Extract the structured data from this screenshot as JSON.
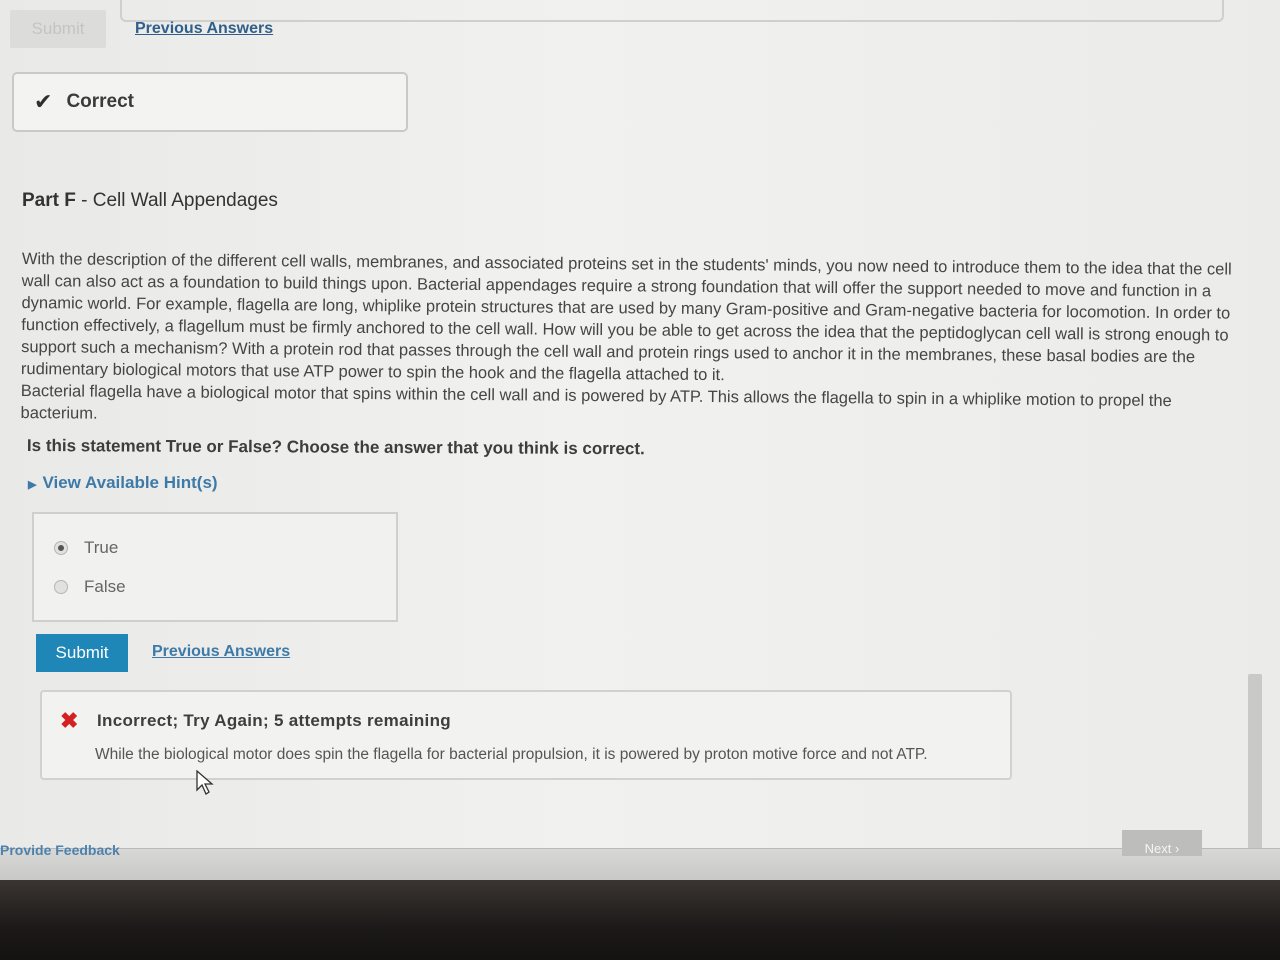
{
  "top": {
    "submit_label": "Submit",
    "previous_answers": "Previous Answers"
  },
  "correct_banner": {
    "icon": "check-icon",
    "text": "Correct"
  },
  "part": {
    "label": "Part F",
    "separator": " - ",
    "title": "Cell Wall Appendages"
  },
  "description": "With the description of the different cell walls, membranes, and associated proteins set in the students' minds, you now need to introduce them to the idea that the cell wall can also act as a foundation to build things upon. Bacterial appendages require a strong foundation that will offer the support needed to move and function in a dynamic world. For example, flagella are long, whiplike protein structures that are used by many Gram-positive and Gram-negative bacteria for locomotion. In order to function effectively, a flagellum must be firmly anchored to the cell wall. How will you be able to get across the idea that the peptidoglycan cell wall is strong enough to support such a mechanism? With a protein rod that passes through the cell wall and protein rings used to anchor it in the membranes, these basal bodies are the rudimentary biological motors that use ATP power to spin the hook and the flagella attached to it.",
  "statement": "Bacterial flagella have a biological motor that spins within the cell wall and is powered by ATP. This allows the flagella to spin in a whiplike motion to propel the bacterium.",
  "question": "Is this statement True or False? Choose the answer that you think is correct.",
  "hints_label": "View Available Hint(s)",
  "options": [
    {
      "label": "True",
      "selected": true
    },
    {
      "label": "False",
      "selected": false
    }
  ],
  "bottom": {
    "submit_label": "Submit",
    "previous_answers": "Previous Answers"
  },
  "feedback": {
    "icon": "x-icon",
    "color": "#d32020",
    "title": "Incorrect; Try Again; 5 attempts remaining",
    "message": "While the biological motor does spin the flagella for bacterial propulsion, it is powered by proton motive force and not ATP."
  },
  "footer": {
    "provide_feedback": "Provide Feedback",
    "next_label": "Next ›"
  },
  "colors": {
    "accent": "#1f86b8",
    "link": "#3d7aa8",
    "error": "#d32020"
  }
}
